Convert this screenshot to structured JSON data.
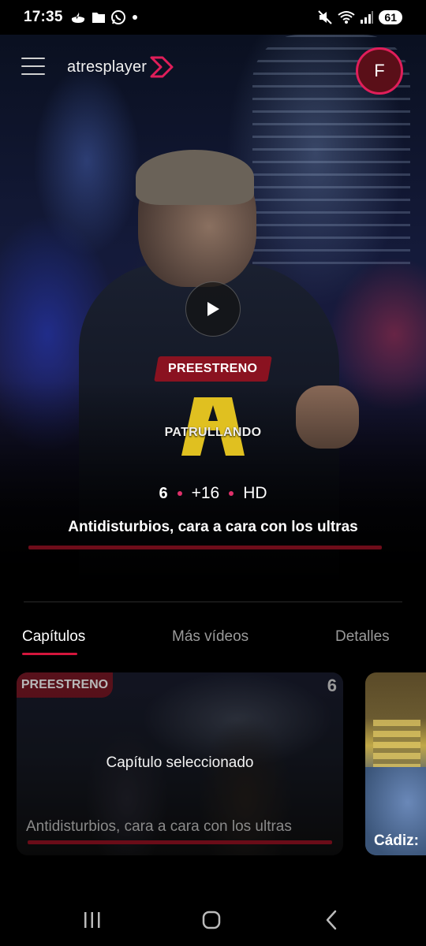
{
  "status_bar": {
    "time": "17:35",
    "left_icons": [
      "santander-icon",
      "folder-icon",
      "whatsapp-icon",
      "dot-icon"
    ],
    "right_icons": [
      "mute-icon",
      "wifi-icon",
      "signal-icon"
    ],
    "battery": "61"
  },
  "header": {
    "logo_text": "atresplayer",
    "avatar_initial": "F",
    "accent_color": "#e01e5a"
  },
  "hero": {
    "badge": "PREESTRENO",
    "show_title": "PATRULLANDO",
    "channel": "6",
    "rating": "+16",
    "quality": "HD",
    "episode_title": "Antidisturbios, cara a cara con los ultras"
  },
  "tabs": [
    {
      "label": "Capítulos",
      "active": true
    },
    {
      "label": "Más vídeos",
      "active": false
    },
    {
      "label": "Detalles",
      "active": false
    }
  ],
  "episodes": [
    {
      "badge": "PREESTRENO",
      "channel": "6",
      "overlay": "Capítulo seleccionado",
      "title": "Antidisturbios, cara a cara con los ultras"
    },
    {
      "title": "Cádiz:"
    }
  ],
  "nav": {
    "buttons": [
      "recent-apps-icon",
      "home-icon",
      "back-icon"
    ]
  }
}
